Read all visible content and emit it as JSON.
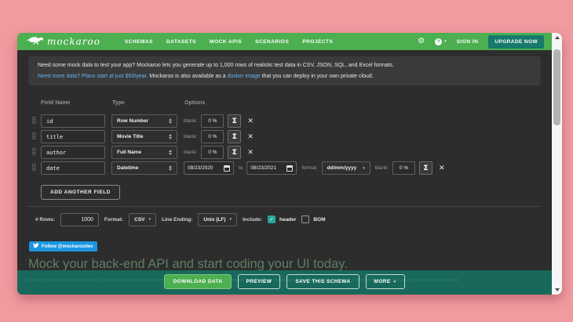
{
  "icons": {
    "gear": "⚙",
    "help": "?",
    "caret": "▾",
    "sigma": "Σ",
    "close": "✕",
    "drag": "⣿",
    "check": "✓"
  },
  "navbar": {
    "brand": "mockaroo",
    "items": [
      "SCHEMAS",
      "DATASETS",
      "MOCK APIS",
      "SCENARIOS",
      "PROJECTS"
    ],
    "sign_in": "SIGN IN",
    "upgrade": "UPGRADE NOW"
  },
  "intro": {
    "line1": "Need some mock data to test your app? Mockaroo lets you generate up to 1,000 rows of realistic test data in CSV, JSON, SQL, and Excel formats.",
    "line2_link1": "Need more data? Plans start at just $50/year.",
    "line2_mid": " Mockaroo is also available as a ",
    "line2_link2": "docker image",
    "line2_end": " that you can deploy in your own private cloud."
  },
  "fields": {
    "headers": {
      "name": "Field Name",
      "type": "Type",
      "options": "Options"
    },
    "rows": [
      {
        "name": "id",
        "type": "Row Number",
        "blank_label": "blank:",
        "blank": "0 %"
      },
      {
        "name": "title",
        "type": "Movie Title",
        "blank_label": "blank:",
        "blank": "0 %"
      },
      {
        "name": "author",
        "type": "Full Name",
        "blank_label": "blank:",
        "blank": "0 %"
      },
      {
        "name": "date",
        "type": "Datetime",
        "date_from": "08/23/2020",
        "to_label": "to",
        "date_to": "08/23/2021",
        "format_label": "format:",
        "format": "dd/mm/yyyy",
        "blank_label": "blank:",
        "blank": "0 %"
      }
    ],
    "add_button": "ADD ANOTHER FIELD"
  },
  "generate": {
    "rows_label": "# Rows:",
    "rows_value": "1000",
    "format_label": "Format:",
    "format_value": "CSV",
    "line_ending_label": "Line Ending:",
    "line_ending_value": "Unix (LF)",
    "include_label": "Include:",
    "header_label": "header",
    "bom_label": "BOM",
    "header_checked": true,
    "bom_checked": false
  },
  "social": {
    "follow": "Follow @mockaroodev"
  },
  "promo": {
    "heading": "Mock your back-end API and start coding your UI today.",
    "paragraph": "It's hard to put together a meaningful UI prototype without making real requests to an API. By making real requests, you'll uncover problems with application flow, timing, and API design early, improving the quality of both the user"
  },
  "footer": {
    "download": "DOWNLOAD DATA",
    "preview": "PREVIEW",
    "save": "SAVE THIS SCHEMA",
    "more": "MORE"
  },
  "colors": {
    "page_bg": "#ef9ba0",
    "navbar_green": "#4caf50",
    "teal": "#177a6d",
    "content_bg": "#2d2d2d",
    "footer_teal": "#18695c",
    "link_blue": "#64b5f6",
    "twitter_blue": "#1b95e0",
    "check_teal": "#26a69a"
  }
}
